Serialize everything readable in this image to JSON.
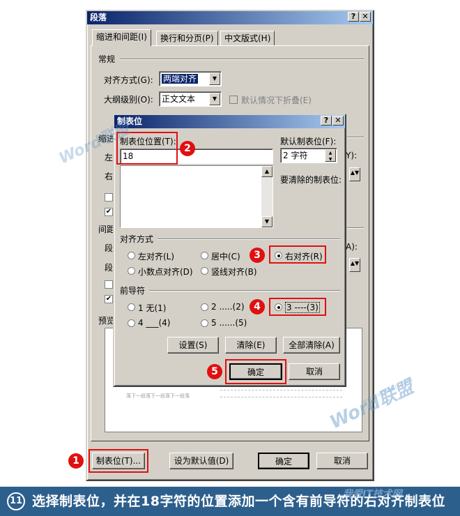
{
  "outer": {
    "title": "段落",
    "tabs": [
      "缩进和间距(I)",
      "换行和分页(P)",
      "中文版式(H)"
    ],
    "section_general": "常规",
    "align_label": "对齐方式(G):",
    "align_value": "两端对齐",
    "outline_label": "大纲级别(O):",
    "outline_value": "正文文本",
    "collapse_label": "默认情况下折叠(E)",
    "indent_partial": "缩进",
    "left_partial": "左",
    "right_partial": "右",
    "spacing_partial": "间距",
    "seg1": "段",
    "seg2": "段",
    "preview_partial": "预览",
    "y_partial": "Y):",
    "a_partial": "A):",
    "preview_text": "落下一段落下一段落下一段落",
    "buttons": {
      "tabs": "制表位(T)...",
      "default": "设为默认值(D)",
      "ok": "确定",
      "cancel": "取消"
    }
  },
  "inner": {
    "title": "制表位",
    "position_label": "制表位位置(T):",
    "position_value": "18",
    "default_label": "默认制表位(F):",
    "default_value": "2 字符",
    "clear_label": "要清除的制表位:",
    "alignment_group": "对齐方式",
    "align_options": [
      "左对齐(L)",
      "居中(C)",
      "右对齐(R)",
      "小数点对齐(D)",
      "竖线对齐(B)"
    ],
    "leader_group": "前导符",
    "leader_options": [
      "1 无(1)",
      "2 .....(2)",
      "3 ----(3)",
      "4 ___(4)",
      "5 ......(5)"
    ],
    "buttons": {
      "set": "设置(S)",
      "clear": "清除(E)",
      "clear_all": "全部清除(A)",
      "ok": "确定",
      "cancel": "取消"
    }
  },
  "badges": [
    "1",
    "2",
    "3",
    "4",
    "5"
  ],
  "watermark": {
    "brand1": "Word联盟",
    "brand2": "Word联盟",
    "url": "www.wordlm.com",
    "site": "我爱IT技术网"
  },
  "caption": {
    "number": "11",
    "text": "选择制表位，并在18字符的位置添加一个含有前导符的右对齐制表位"
  },
  "colors": {
    "accent_red": "#e01010",
    "caption_bg": "#2d5f8d",
    "title_blue": "#0a246a"
  }
}
